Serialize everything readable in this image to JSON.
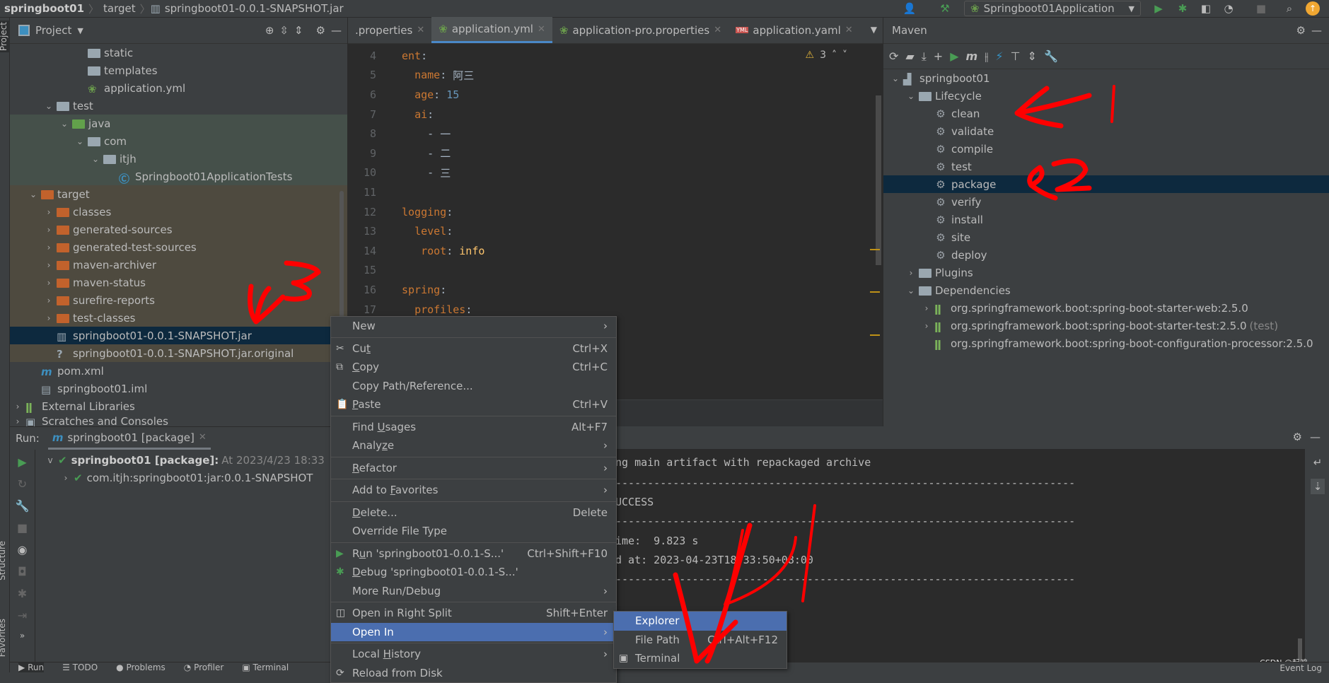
{
  "navbar": {
    "crumbs": [
      "springboot01",
      "target",
      "springboot01-0.0.1-SNAPSHOT.jar"
    ],
    "run_config": "Springboot01Application"
  },
  "side_stripe": {
    "project": "Project",
    "structure": "Structure",
    "favorites": "Favorites"
  },
  "project": {
    "title": "Project",
    "tree": [
      {
        "label": "static",
        "depth": 4,
        "icon": "folder-icon",
        "chev": "",
        "tint": ""
      },
      {
        "label": "templates",
        "depth": 4,
        "icon": "folder-icon",
        "chev": "",
        "tint": ""
      },
      {
        "label": "application.yml",
        "depth": 4,
        "icon": "spring-config-icon",
        "chev": "",
        "tint": ""
      },
      {
        "label": "test",
        "depth": 2,
        "icon": "folder-icon",
        "chev": "v",
        "tint": ""
      },
      {
        "label": "java",
        "depth": 3,
        "icon": "test-folder-icon",
        "chev": "v",
        "tint": "green"
      },
      {
        "label": "com",
        "depth": 4,
        "icon": "package-icon",
        "chev": "v",
        "tint": "green"
      },
      {
        "label": "itjh",
        "depth": 5,
        "icon": "package-icon",
        "chev": "v",
        "tint": "green"
      },
      {
        "label": "Springboot01ApplicationTests",
        "depth": 6,
        "icon": "test-class-icon",
        "chev": "",
        "tint": "green"
      },
      {
        "label": "target",
        "depth": 1,
        "icon": "excluded-folder-icon",
        "chev": "v",
        "tint": "brown"
      },
      {
        "label": "classes",
        "depth": 2,
        "icon": "excluded-folder-icon",
        "chev": ">",
        "tint": "brown"
      },
      {
        "label": "generated-sources",
        "depth": 2,
        "icon": "excluded-folder-icon",
        "chev": ">",
        "tint": "brown"
      },
      {
        "label": "generated-test-sources",
        "depth": 2,
        "icon": "excluded-folder-icon",
        "chev": ">",
        "tint": "brown"
      },
      {
        "label": "maven-archiver",
        "depth": 2,
        "icon": "excluded-folder-icon",
        "chev": ">",
        "tint": "brown"
      },
      {
        "label": "maven-status",
        "depth": 2,
        "icon": "excluded-folder-icon",
        "chev": ">",
        "tint": "brown"
      },
      {
        "label": "surefire-reports",
        "depth": 2,
        "icon": "excluded-folder-icon",
        "chev": ">",
        "tint": "brown"
      },
      {
        "label": "test-classes",
        "depth": 2,
        "icon": "excluded-folder-icon",
        "chev": ">",
        "tint": "brown"
      },
      {
        "label": "springboot01-0.0.1-SNAPSHOT.jar",
        "depth": 2,
        "icon": "jar-icon",
        "chev": "",
        "tint": "sel"
      },
      {
        "label": "springboot01-0.0.1-SNAPSHOT.jar.original",
        "depth": 2,
        "icon": "unknown-file-icon",
        "chev": "",
        "tint": "brown"
      },
      {
        "label": "pom.xml",
        "depth": 1,
        "icon": "maven-icon",
        "chev": "",
        "tint": ""
      },
      {
        "label": "springboot01.iml",
        "depth": 1,
        "icon": "iml-file-icon",
        "chev": "",
        "tint": ""
      },
      {
        "label": "External Libraries",
        "depth": 0,
        "icon": "library-icon",
        "chev": ">",
        "tint": ""
      },
      {
        "label": "Scratches and Consoles",
        "depth": 0,
        "icon": "scratches-icon",
        "chev": ">",
        "tint": ""
      }
    ]
  },
  "editor": {
    "tabs": [
      {
        "label": ".properties",
        "active": false,
        "icon": ""
      },
      {
        "label": "application.yml",
        "active": true,
        "icon": "spring-config-icon"
      },
      {
        "label": "application-pro.properties",
        "active": false,
        "icon": "spring-config-icon"
      },
      {
        "label": "application.yaml",
        "active": false,
        "icon": "yml-icon"
      }
    ],
    "warnings": "3",
    "lines": [
      {
        "n": "4",
        "indent": "",
        "key": "ent",
        "sep": ":",
        "value": "",
        "vtype": ""
      },
      {
        "n": "5",
        "indent": "  ",
        "key": "name",
        "sep": ": ",
        "value": "阿三",
        "vtype": "vs"
      },
      {
        "n": "6",
        "indent": "  ",
        "key": "age",
        "sep": ": ",
        "value": "15",
        "vtype": "vn"
      },
      {
        "n": "7",
        "indent": "  ",
        "key": "ai",
        "sep": ":",
        "value": "",
        "vtype": ""
      },
      {
        "n": "8",
        "indent": "    ",
        "key": "",
        "sep": "- ",
        "value": "一",
        "vtype": "vs"
      },
      {
        "n": "9",
        "indent": "    ",
        "key": "",
        "sep": "- ",
        "value": "二",
        "vtype": "vs"
      },
      {
        "n": "10",
        "indent": "    ",
        "key": "",
        "sep": "- ",
        "value": "三",
        "vtype": "vs"
      },
      {
        "n": "11",
        "indent": "",
        "key": "",
        "sep": "",
        "value": "",
        "vtype": ""
      },
      {
        "n": "12",
        "indent": "",
        "key": "logging",
        "sep": ":",
        "value": "",
        "vtype": ""
      },
      {
        "n": "13",
        "indent": "  ",
        "key": "level",
        "sep": ":",
        "value": "",
        "vtype": ""
      },
      {
        "n": "14",
        "indent": "   ",
        "key": "root",
        "sep": ": ",
        "value": "info",
        "vtype": "vy"
      },
      {
        "n": "15",
        "indent": "",
        "key": "",
        "sep": "",
        "value": "",
        "vtype": ""
      },
      {
        "n": "16",
        "indent": "",
        "key": "spring",
        "sep": ":",
        "value": "",
        "vtype": ""
      },
      {
        "n": "17",
        "indent": "  ",
        "key": "profiles",
        "sep": ":",
        "value": "",
        "vtype": ""
      }
    ]
  },
  "maven": {
    "title": "Maven",
    "tree": [
      {
        "label": "springboot01",
        "depth": 0,
        "chev": "v",
        "icon": "maven-project-icon",
        "sel": false,
        "suffix": ""
      },
      {
        "label": "Lifecycle",
        "depth": 1,
        "chev": "v",
        "icon": "lifecycle-folder-icon",
        "sel": false,
        "suffix": ""
      },
      {
        "label": "clean",
        "depth": 2,
        "chev": "",
        "icon": "gear-icon",
        "sel": false,
        "suffix": ""
      },
      {
        "label": "validate",
        "depth": 2,
        "chev": "",
        "icon": "gear-icon",
        "sel": false,
        "suffix": ""
      },
      {
        "label": "compile",
        "depth": 2,
        "chev": "",
        "icon": "gear-icon",
        "sel": false,
        "suffix": ""
      },
      {
        "label": "test",
        "depth": 2,
        "chev": "",
        "icon": "gear-icon",
        "sel": false,
        "suffix": ""
      },
      {
        "label": "package",
        "depth": 2,
        "chev": "",
        "icon": "gear-icon",
        "sel": true,
        "suffix": ""
      },
      {
        "label": "verify",
        "depth": 2,
        "chev": "",
        "icon": "gear-icon",
        "sel": false,
        "suffix": ""
      },
      {
        "label": "install",
        "depth": 2,
        "chev": "",
        "icon": "gear-icon",
        "sel": false,
        "suffix": ""
      },
      {
        "label": "site",
        "depth": 2,
        "chev": "",
        "icon": "gear-icon",
        "sel": false,
        "suffix": ""
      },
      {
        "label": "deploy",
        "depth": 2,
        "chev": "",
        "icon": "gear-icon",
        "sel": false,
        "suffix": ""
      },
      {
        "label": "Plugins",
        "depth": 1,
        "chev": ">",
        "icon": "plugins-folder-icon",
        "sel": false,
        "suffix": ""
      },
      {
        "label": "Dependencies",
        "depth": 1,
        "chev": "v",
        "icon": "dependencies-folder-icon",
        "sel": false,
        "suffix": ""
      },
      {
        "label": "org.springframework.boot:spring-boot-starter-web:2.5.0",
        "depth": 2,
        "chev": ">",
        "icon": "library-icon",
        "sel": false,
        "suffix": ""
      },
      {
        "label": "org.springframework.boot:spring-boot-starter-test:2.5.0",
        "depth": 2,
        "chev": ">",
        "icon": "library-icon",
        "sel": false,
        "suffix": "(test)"
      },
      {
        "label": "org.springframework.boot:spring-boot-configuration-processor:2.5.0",
        "depth": 2,
        "chev": "",
        "icon": "library-icon",
        "sel": false,
        "suffix": ""
      }
    ]
  },
  "run": {
    "label": "Run:",
    "tab": "springboot01 [package]",
    "root": "springboot01 [package]:",
    "root_time": "At 2023/4/23 18:33",
    "child": "com.itjh:springboot01:jar:0.0.1-SNAPSHOT"
  },
  "console": {
    "lines": [
      "ng main artifact with repackaged archive",
      "------------------------------------------------------------------------",
      "UCCESS",
      "------------------------------------------------------------------------",
      "ime:  9.823 s",
      "d at: 2023-04-23T18:33:50+08:00",
      "------------------------------------------------------------------------"
    ]
  },
  "bottom_tabs": [
    "Run",
    "TODO",
    "Problems",
    "Profiler",
    "Terminal"
  ],
  "event_log": "Event Log",
  "watermark": "CSDN @起鸣",
  "context_menu": {
    "items": [
      {
        "label": "New",
        "u": "",
        "shortcut": "",
        "arrow": true,
        "icon": "",
        "sep_after": true
      },
      {
        "label": "Cut",
        "u": "t",
        "shortcut": "Ctrl+X",
        "arrow": false,
        "icon": "cut-icon",
        "sep_after": false
      },
      {
        "label": "Copy",
        "u": "C",
        "shortcut": "Ctrl+C",
        "arrow": false,
        "icon": "copy-icon",
        "sep_after": false
      },
      {
        "label": "Copy Path/Reference...",
        "u": "",
        "shortcut": "",
        "arrow": false,
        "icon": "",
        "sep_after": false
      },
      {
        "label": "Paste",
        "u": "P",
        "shortcut": "Ctrl+V",
        "arrow": false,
        "icon": "paste-icon",
        "sep_after": true
      },
      {
        "label": "Find Usages",
        "u": "U",
        "shortcut": "Alt+F7",
        "arrow": false,
        "icon": "",
        "sep_after": false
      },
      {
        "label": "Analyze",
        "u": "z",
        "shortcut": "",
        "arrow": true,
        "icon": "",
        "sep_after": true
      },
      {
        "label": "Refactor",
        "u": "R",
        "shortcut": "",
        "arrow": true,
        "icon": "",
        "sep_after": true
      },
      {
        "label": "Add to Favorites",
        "u": "F",
        "shortcut": "",
        "arrow": true,
        "icon": "",
        "sep_after": true
      },
      {
        "label": "Delete...",
        "u": "D",
        "shortcut": "Delete",
        "arrow": false,
        "icon": "",
        "sep_after": false
      },
      {
        "label": "Override File Type",
        "u": "",
        "shortcut": "",
        "arrow": false,
        "icon": "",
        "sep_after": true
      },
      {
        "label": "Run 'springboot01-0.0.1-S...'",
        "u": "u",
        "shortcut": "Ctrl+Shift+F10",
        "arrow": false,
        "icon": "run-icon",
        "sep_after": false
      },
      {
        "label": "Debug 'springboot01-0.0.1-S...'",
        "u": "D",
        "shortcut": "",
        "arrow": false,
        "icon": "debug-icon",
        "sep_after": false
      },
      {
        "label": "More Run/Debug",
        "u": "",
        "shortcut": "",
        "arrow": true,
        "icon": "",
        "sep_after": true
      },
      {
        "label": "Open in Right Split",
        "u": "",
        "shortcut": "Shift+Enter",
        "arrow": false,
        "icon": "split-icon",
        "sep_after": false
      },
      {
        "label": "Open In",
        "u": "",
        "shortcut": "",
        "arrow": true,
        "icon": "",
        "sep_after": true,
        "hl": true
      },
      {
        "label": "Local History",
        "u": "H",
        "shortcut": "",
        "arrow": true,
        "icon": "",
        "sep_after": false
      },
      {
        "label": "Reload from Disk",
        "u": "",
        "shortcut": "",
        "arrow": false,
        "icon": "reload-icon",
        "sep_after": false
      }
    ]
  },
  "submenu": {
    "items": [
      {
        "label": "Explorer",
        "shortcut": "",
        "icon": "",
        "hl": true
      },
      {
        "label": "File Path",
        "shortcut": "Ctrl+Alt+F12",
        "icon": "",
        "hl": false
      },
      {
        "label": "Terminal",
        "shortcut": "",
        "icon": "terminal-icon",
        "hl": false
      }
    ]
  },
  "annotations": {
    "color": "#ff0000",
    "labels": [
      "1",
      "2",
      "3",
      "4"
    ]
  },
  "colors": {
    "accent": "#4b6eaf",
    "selection": "#0d293e",
    "run_green": "#499c54"
  }
}
